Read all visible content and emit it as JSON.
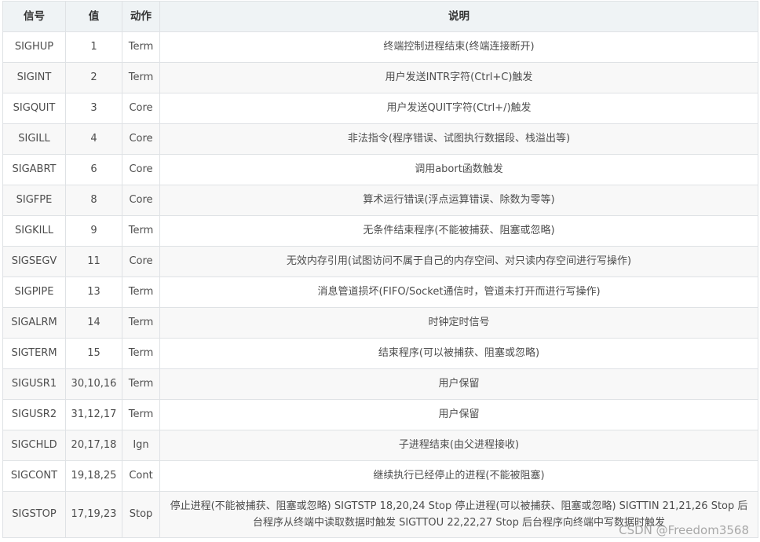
{
  "table": {
    "headers": [
      "信号",
      "值",
      "动作",
      "说明"
    ],
    "rows": [
      {
        "signal": "SIGHUP",
        "value": "1",
        "action": "Term",
        "description": "终端控制进程结束(终端连接断开)"
      },
      {
        "signal": "SIGINT",
        "value": "2",
        "action": "Term",
        "description": "用户发送INTR字符(Ctrl+C)触发"
      },
      {
        "signal": "SIGQUIT",
        "value": "3",
        "action": "Core",
        "description": "用户发送QUIT字符(Ctrl+/)触发"
      },
      {
        "signal": "SIGILL",
        "value": "4",
        "action": "Core",
        "description": "非法指令(程序错误、试图执行数据段、栈溢出等)"
      },
      {
        "signal": "SIGABRT",
        "value": "6",
        "action": "Core",
        "description": "调用abort函数触发"
      },
      {
        "signal": "SIGFPE",
        "value": "8",
        "action": "Core",
        "description": "算术运行错误(浮点运算错误、除数为零等)"
      },
      {
        "signal": "SIGKILL",
        "value": "9",
        "action": "Term",
        "description": "无条件结束程序(不能被捕获、阻塞或忽略)"
      },
      {
        "signal": "SIGSEGV",
        "value": "11",
        "action": "Core",
        "description": "无效内存引用(试图访问不属于自己的内存空间、对只读内存空间进行写操作)"
      },
      {
        "signal": "SIGPIPE",
        "value": "13",
        "action": "Term",
        "description": "消息管道损坏(FIFO/Socket通信时，管道未打开而进行写操作)"
      },
      {
        "signal": "SIGALRM",
        "value": "14",
        "action": "Term",
        "description": "时钟定时信号"
      },
      {
        "signal": "SIGTERM",
        "value": "15",
        "action": "Term",
        "description": "结束程序(可以被捕获、阻塞或忽略)"
      },
      {
        "signal": "SIGUSR1",
        "value": "30,10,16",
        "action": "Term",
        "description": "用户保留"
      },
      {
        "signal": "SIGUSR2",
        "value": "31,12,17",
        "action": "Term",
        "description": "用户保留"
      },
      {
        "signal": "SIGCHLD",
        "value": "20,17,18",
        "action": "Ign",
        "description": "子进程结束(由父进程接收)"
      },
      {
        "signal": "SIGCONT",
        "value": "19,18,25",
        "action": "Cont",
        "description": "继续执行已经停止的进程(不能被阻塞)"
      },
      {
        "signal": "SIGSTOP",
        "value": "17,19,23",
        "action": "Stop",
        "description": "停止进程(不能被捕获、阻塞或忽略) SIGTSTP 18,20,24 Stop 停止进程(可以被捕获、阻塞或忽略) SIGTTIN 21,21,26 Stop 后台程序从终端中读取数据时触发 SIGTTOU 22,22,27 Stop 后台程序向终端中写数据时触发"
      }
    ]
  },
  "watermark": "CSDN @Freedom3568"
}
